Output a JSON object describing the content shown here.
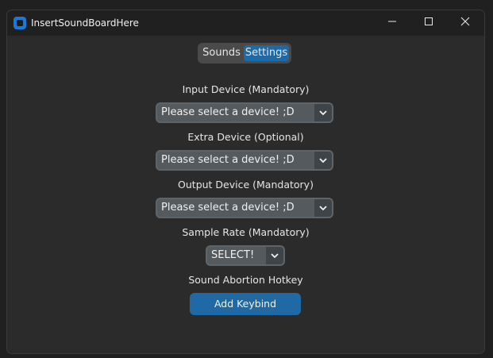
{
  "window": {
    "title": "InsertSoundBoardHere"
  },
  "tabs": [
    {
      "label": "Sounds",
      "active": false
    },
    {
      "label": "Settings",
      "active": true
    }
  ],
  "settings": {
    "input_label": "Input Device (Mandatory)",
    "input_value": "Please select a device! ;D",
    "extra_label": "Extra Device (Optional)",
    "extra_value": "Please select a device! ;D",
    "output_label": "Output Device (Mandatory)",
    "output_value": "Please select a device! ;D",
    "rate_label": "Sample Rate (Mandatory)",
    "rate_value": "SELECT!",
    "hotkey_label": "Sound Abortion Hotkey",
    "keybind_button": "Add Keybind"
  },
  "colors": {
    "accent": "#1f6aa5",
    "app_icon": "#1c78d9",
    "background": "#2b2b2b",
    "titlebar": "#202020"
  },
  "icons": [
    "app-logo-icon",
    "minimize-icon",
    "maximize-icon",
    "close-icon",
    "chevron-down-icon"
  ]
}
